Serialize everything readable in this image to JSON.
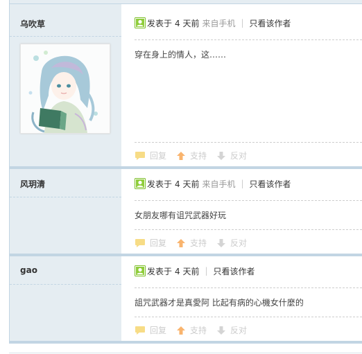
{
  "posts": [
    {
      "author": "乌吹草",
      "meta_prefix": "发表于",
      "time": "4 天前",
      "source": "来自手机",
      "only_author": "只看该作者",
      "content": "穿在身上的情人，这……",
      "reply": "回复",
      "support": "支持",
      "oppose": "反对",
      "has_avatar": true
    },
    {
      "author": "风玥清",
      "meta_prefix": "发表于",
      "time": "4 天前",
      "source": "来自手机",
      "only_author": "只看该作者",
      "content": "女朋友哪有诅咒武器好玩",
      "reply": "回复",
      "support": "支持",
      "oppose": "反对",
      "has_avatar": false
    },
    {
      "author": "gao",
      "meta_prefix": "发表于",
      "time": "4 天前",
      "source": "",
      "only_author": "只看该作者",
      "content": "詛咒武器才是真愛阿 比起有病的心機女什麼的",
      "reply": "回复",
      "support": "支持",
      "oppose": "反对",
      "has_avatar": false
    }
  ],
  "colors": {
    "side_bg": "#e5edf2",
    "border": "#c2d5e3",
    "online_icon": "#7cbe2a",
    "reply_icon": "#f6d97a",
    "support_icon": "#f8b26a",
    "oppose_icon": "#d0d0d0"
  }
}
